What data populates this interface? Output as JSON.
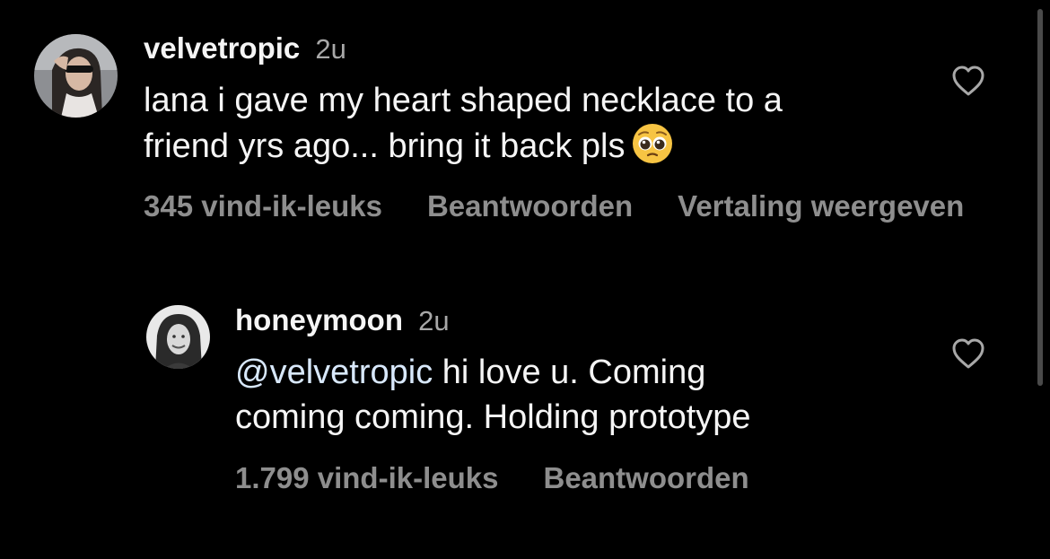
{
  "comments": [
    {
      "username": "velvetropic",
      "time": "2u",
      "text_line1": "lana i gave my heart shaped necklace to a",
      "text_line2": "friend yrs ago... bring it back pls",
      "emoji": "pleading-face-emoji",
      "likes": "345 vind-ik-leuks",
      "reply": "Beantwoorden",
      "translate": "Vertaling weergeven"
    },
    {
      "username": "honeymoon",
      "time": "2u",
      "mention": "@velvetropic",
      "text_line1_rest": " hi love u.  Coming",
      "text_line2": "coming coming. Holding prototype",
      "likes": "1.799 vind-ik-leuks",
      "reply": "Beantwoorden"
    }
  ],
  "colors": {
    "background": "#000000",
    "text": "#f5f5f5",
    "secondary": "#8e8e8e",
    "mention": "#d8e8fb"
  },
  "icons": [
    "heart-outline-icon",
    "pleading-face-emoji"
  ]
}
